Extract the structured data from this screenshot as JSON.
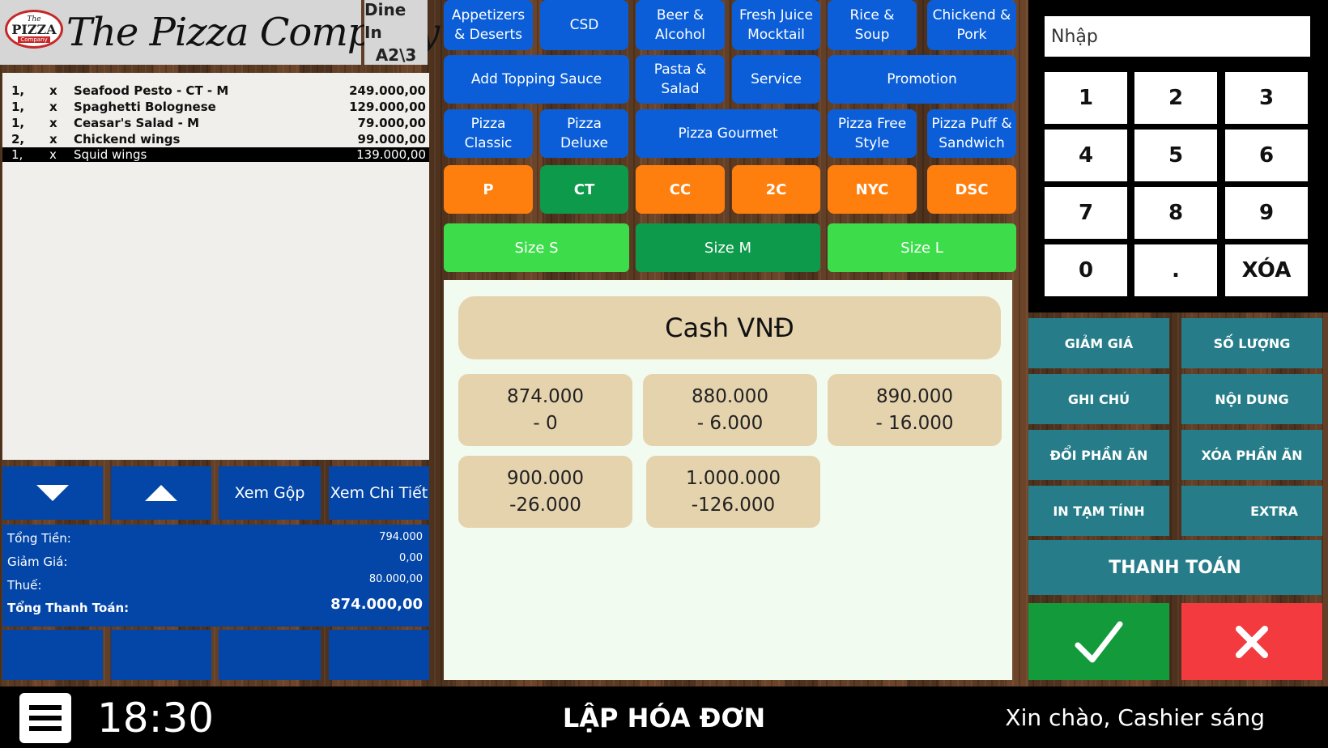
{
  "header": {
    "logo_top": "The",
    "logo_main": "PIZZA",
    "logo_bottom": "Company",
    "title": "The Pizza Company",
    "order_type": "Dine In",
    "table": "A2\\3"
  },
  "order": {
    "items": [
      {
        "qty": "1,",
        "x": "x",
        "name": "Seafood Pesto - CT - M",
        "price": "249.000,00"
      },
      {
        "qty": "1,",
        "x": "x",
        "name": "Spaghetti Bolognese",
        "price": "129.000,00"
      },
      {
        "qty": "1,",
        "x": "x",
        "name": "Ceasar's Salad - M",
        "price": "79.000,00"
      },
      {
        "qty": "2,",
        "x": "x",
        "name": "Chickend wings",
        "price": "99.000,00"
      },
      {
        "qty": "1,",
        "x": "x",
        "name": "Squid wings",
        "price": "139.000,00"
      }
    ]
  },
  "list_nav": {
    "xem_gop": "Xem Gộp",
    "xem_chi_tiet": "Xem Chi Tiết"
  },
  "totals": {
    "tong_tien_label": "Tổng Tiền:",
    "tong_tien_value": "794.000",
    "giam_gia_label": "Giảm Giá:",
    "giam_gia_value": "0,00",
    "thue_label": "Thuế:",
    "thue_value": "80.000,00",
    "tong_thanh_toan_label": "Tổng Thanh Toán:",
    "tong_thanh_toan_value": "874.000,00"
  },
  "categories": {
    "appetizers": "Appetizers & Deserts",
    "csd": "CSD",
    "beer": "Beer & Alcohol",
    "juice": "Fresh Juice Mocktail",
    "rice": "Rice & Soup",
    "chicken": "Chickend & Pork",
    "topping": "Add Topping Sauce",
    "pasta": "Pasta & Salad",
    "service": "Service",
    "promotion": "Promotion",
    "pizza_classic": "Pizza Classic",
    "pizza_deluxe": "Pizza Deluxe",
    "pizza_gourmet": "Pizza Gourmet",
    "pizza_free": "Pizza Free Style",
    "pizza_puff": "Pizza Puff & Sandwich"
  },
  "crusts": {
    "p": "P",
    "ct": "CT",
    "cc": "CC",
    "two_c": "2C",
    "nyc": "NYC",
    "dsc": "DSC"
  },
  "sizes": {
    "s": "Size S",
    "m": "Size M",
    "l": "Size L"
  },
  "cash": {
    "title": "Cash VNĐ",
    "options": [
      {
        "amount": "874.000",
        "change": "- 0"
      },
      {
        "amount": "880.000",
        "change": "- 6.000"
      },
      {
        "amount": "890.000",
        "change": "- 16.000"
      },
      {
        "amount": "900.000",
        "change": "-26.000"
      },
      {
        "amount": "1.000.000",
        "change": "-126.000"
      }
    ]
  },
  "numpad": {
    "placeholder": "Nhập",
    "keys": [
      "1",
      "2",
      "3",
      "4",
      "5",
      "6",
      "7",
      "8",
      "9",
      "0",
      ".",
      "XÓA"
    ]
  },
  "actions": {
    "giam_gia": "GIẢM GIÁ",
    "so_luong": "SỐ LƯỢNG",
    "ghi_chu": "GHI CHÚ",
    "noi_dung": "NỘI DUNG",
    "doi_phan_an": "ĐỔI PHẦN ĂN",
    "xoa_phan_an": "XÓA PHẦN ĂN",
    "in_tam_tinh": "IN TẠM TÍNH",
    "extra": "EXTRA",
    "thanh_toan": "THANH TOÁN"
  },
  "footer": {
    "time": "18:30",
    "screen_title": "LẬP HÓA ĐƠN",
    "greeting": "Xin chào, Cashier sáng"
  },
  "colors": {
    "primary_blue": "#0446a8",
    "category_blue": "#0b5ed7",
    "crust_orange": "#ff7f0e",
    "selected_green": "#0d9a4a",
    "size_green": "#3ddc4a",
    "action_teal": "#267d89",
    "confirm_green": "#139a3b",
    "cancel_red": "#f23a3f",
    "cash_beige": "#e5d3ae"
  }
}
